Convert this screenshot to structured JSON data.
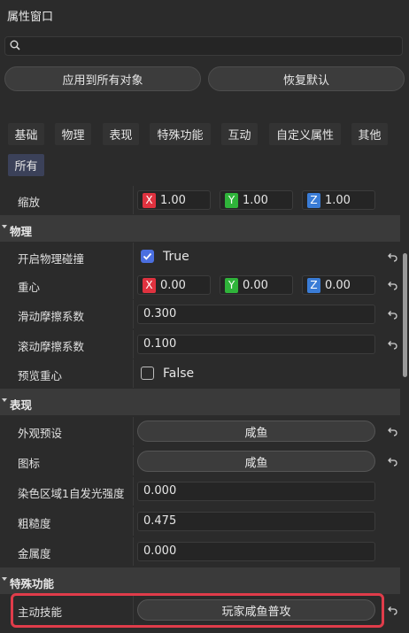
{
  "window": {
    "title": "属性窗口"
  },
  "search": {
    "placeholder": ""
  },
  "actions": {
    "apply_all": "应用到所有对象",
    "restore_default": "恢复默认"
  },
  "tabs": [
    "基础",
    "物理",
    "表现",
    "特殊功能",
    "互动",
    "自定义属性",
    "其他",
    "所有"
  ],
  "active_tab": "所有",
  "scale": {
    "label": "缩放",
    "x_axis": "X",
    "y_axis": "Y",
    "z_axis": "Z",
    "x": "1.00",
    "y": "1.00",
    "z": "1.00"
  },
  "physics": {
    "header": "物理",
    "collision": {
      "label": "开启物理碰撞",
      "value": "True",
      "checked": true
    },
    "center": {
      "label": "重心",
      "x_axis": "X",
      "y_axis": "Y",
      "z_axis": "Z",
      "x": "0.00",
      "y": "0.00",
      "z": "0.00"
    },
    "sliding_friction": {
      "label": "滑动摩擦系数",
      "value": "0.300"
    },
    "rolling_friction": {
      "label": "滚动摩擦系数",
      "value": "0.100"
    },
    "preview_center": {
      "label": "预览重心",
      "value": "False",
      "checked": false
    }
  },
  "appearance": {
    "header": "表现",
    "preset": {
      "label": "外观预设",
      "value": "咸鱼"
    },
    "icon": {
      "label": "图标",
      "value": "咸鱼"
    },
    "dye_glow": {
      "label": "染色区域1自发光强度",
      "value": "0.000"
    },
    "roughness": {
      "label": "粗糙度",
      "value": "0.475"
    },
    "metallic": {
      "label": "金属度",
      "value": "0.000"
    }
  },
  "special": {
    "header": "特殊功能",
    "active_skill": {
      "label": "主动技能",
      "value": "玩家咸鱼普攻"
    }
  },
  "colors": {
    "accent_blue": "#4b6fe0",
    "highlight_red": "#e03c4a",
    "axis_x": "#e0323f",
    "axis_y": "#2fb43a",
    "axis_z": "#3a7cd6"
  }
}
